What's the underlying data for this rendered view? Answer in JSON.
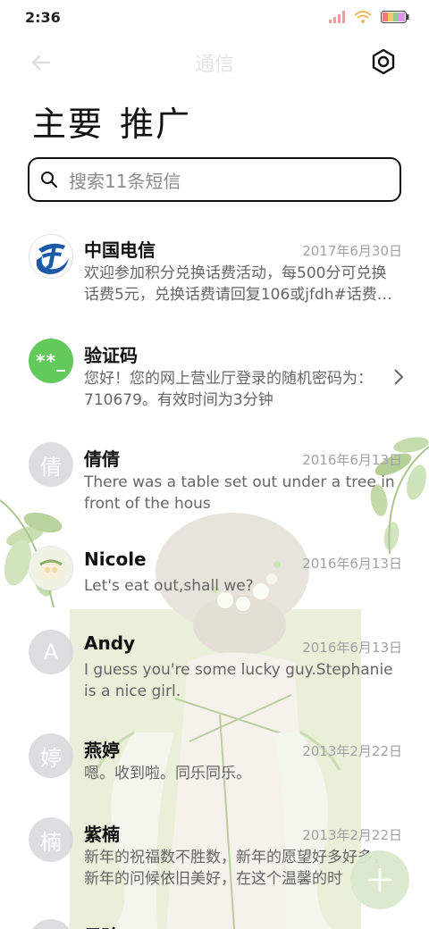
{
  "status_bar": {
    "time": "2:36"
  },
  "toolbar": {
    "title": "通信",
    "settings_icon": "gear-icon"
  },
  "tabs": [
    {
      "label": "主要"
    },
    {
      "label": "推广"
    }
  ],
  "search": {
    "placeholder": "搜索11条短信"
  },
  "messages": [
    {
      "avatar_text": "",
      "avatar_type": "logo",
      "sender": "中国电信",
      "date": "2017年6月30日",
      "preview": "欢迎参加积分兑换话费活动，每500分可兑换话费5元，兑换话费请回复106或jfdh#话费…"
    },
    {
      "avatar_text": "**_",
      "avatar_type": "green",
      "sender": "验证码",
      "date": "",
      "preview": "您好！您的网上营业厅登录的随机密码为：710679。有效时间为3分钟"
    },
    {
      "avatar_text": "倩",
      "avatar_type": "letter",
      "sender": "倩倩",
      "date": "2016年6月13日",
      "preview": "There was a table set out under a tree in front of the hous"
    },
    {
      "avatar_text": "",
      "avatar_type": "photo",
      "sender": "Nicole",
      "date": "2016年6月13日",
      "preview": "Let's eat out,shall we?"
    },
    {
      "avatar_text": "A",
      "avatar_type": "letter",
      "sender": "Andy",
      "date": "2016年6月13日",
      "preview": "I guess you're some lucky guy.Stephanie is a nice girl."
    },
    {
      "avatar_text": "婷",
      "avatar_type": "letter",
      "sender": "燕婷",
      "date": "2013年2月22日",
      "preview": "嗯。收到啦。同乐同乐。"
    },
    {
      "avatar_text": "楠",
      "avatar_type": "letter",
      "sender": "紫楠",
      "date": "2013年2月22日",
      "preview": "新年的祝福数不胜数，新年的愿望好多好多，新年的问候依旧美好，在这个温馨的时"
    },
    {
      "avatar_text": "",
      "avatar_type": "letter",
      "sender": "子玲",
      "date": "",
      "preview": ""
    }
  ],
  "fab": {
    "icon": "plus-icon"
  },
  "colors": {
    "accent_green": "#62c95a",
    "fab_bg": "#dae8cc",
    "telecom_blue": "#1a5aa8"
  }
}
